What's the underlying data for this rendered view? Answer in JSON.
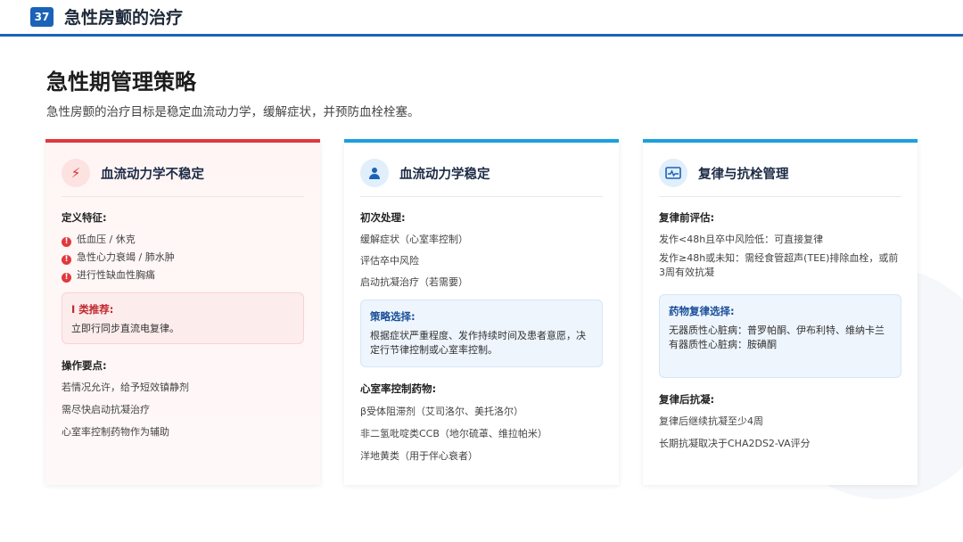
{
  "page": {
    "number": "37",
    "title": "急性房颤的治疗",
    "heading": "急性期管理策略",
    "subtitle": "急性房颤的治疗目标是稳定血流动力学，缓解症状，并预防血栓栓塞。"
  },
  "colors": {
    "brand": "#1a63b8",
    "red": "#e0393e",
    "cyan": "#1aa0dc"
  },
  "cards": {
    "unstable": {
      "icon": "lightning-icon",
      "title": "血流动力学不稳定",
      "def_label": "定义特征:",
      "items": [
        "低血压 / 休克",
        "急性心力衰竭 / 肺水肿",
        "进行性缺血性胸痛"
      ],
      "box_title": "I 类推荐:",
      "box_text": "立即行同步直流电复律。",
      "ops_label": "操作要点:",
      "ops": [
        "若情况允许，给予短效镇静剂",
        "需尽快启动抗凝治疗",
        "心室率控制药物作为辅助"
      ]
    },
    "stable": {
      "icon": "user-doctor-icon",
      "title": "血流动力学稳定",
      "init_label": "初次处理:",
      "init": [
        "缓解症状（心室率控制）",
        "评估卒中风险",
        "启动抗凝治疗（若需要）"
      ],
      "box_title": "策略选择:",
      "box_text": "根据症状严重程度、发作持续时间及患者意愿，决定行节律控制或心室率控制。",
      "drugs_label": "心室率控制药物:",
      "drugs": [
        "β受体阻滞剂（艾司洛尔、美托洛尔）",
        "非二氢吡啶类CCB（地尔硫䓬、维拉帕米）",
        "洋地黄类（用于伴心衰者）"
      ]
    },
    "rhythm": {
      "icon": "heart-monitor-icon",
      "title": "复律与抗栓管理",
      "pre_label": "复律前评估:",
      "pre": [
        "发作<48h且卒中风险低：可直接复律",
        "发作≥48h或未知：需经食管超声(TEE)排除血栓，或前3周有效抗凝"
      ],
      "box_title": "药物复律选择:",
      "box_lines": [
        "无器质性心脏病：普罗帕酮、伊布利特、维纳卡兰",
        "有器质性心脏病：胺碘酮"
      ],
      "post_label": "复律后抗凝:",
      "post": [
        "复律后继续抗凝至少4周",
        "长期抗凝取决于CHA2DS2-VA评分"
      ]
    }
  }
}
